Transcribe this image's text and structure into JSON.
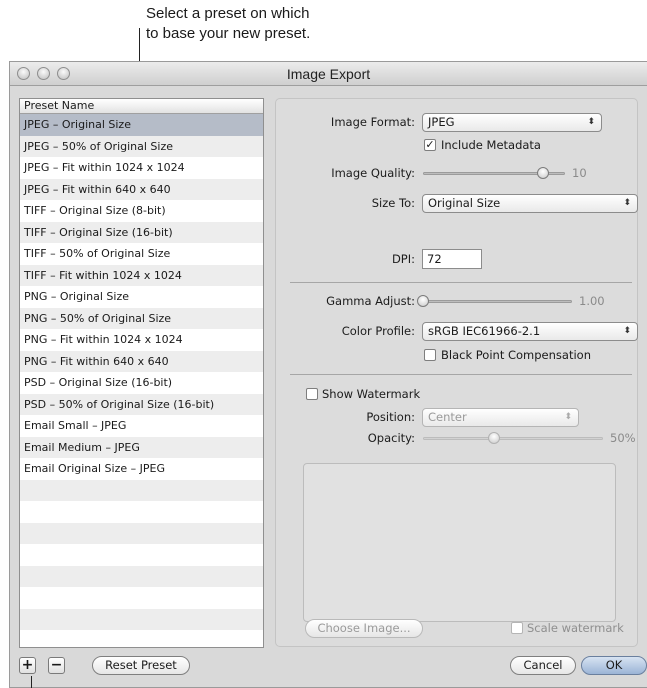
{
  "callout": {
    "line1": "Select a preset on which",
    "line2": "to base your new preset."
  },
  "window": {
    "title": "Image Export"
  },
  "presets": {
    "header": "Preset Name",
    "items": [
      "JPEG – Original Size",
      "JPEG – 50% of Original Size",
      "JPEG – Fit within 1024 x 1024",
      "JPEG – Fit within 640 x 640",
      "TIFF – Original Size (8-bit)",
      "TIFF – Original Size (16-bit)",
      "TIFF – 50% of Original Size",
      "TIFF – Fit within 1024 x 1024",
      "PNG – Original Size",
      "PNG – 50% of Original Size",
      "PNG – Fit within 1024 x 1024",
      "PNG – Fit within 640 x 640",
      "PSD – Original Size (16-bit)",
      "PSD – 50% of Original Size (16-bit)",
      "Email Small – JPEG",
      "Email Medium – JPEG",
      "Email Original Size – JPEG",
      "",
      "",
      "",
      "",
      "",
      "",
      ""
    ],
    "selected_index": 0
  },
  "settings": {
    "image_format_label": "Image Format:",
    "image_format_value": "JPEG",
    "include_metadata_label": "Include Metadata",
    "include_metadata_checked": "✓",
    "image_quality_label": "Image Quality:",
    "image_quality_value": "10",
    "size_to_label": "Size To:",
    "size_to_value": "Original Size",
    "dpi_label": "DPI:",
    "dpi_value": "72",
    "gamma_label": "Gamma Adjust:",
    "gamma_value": "1.00",
    "color_profile_label": "Color Profile:",
    "color_profile_value": "sRGB IEC61966-2.1",
    "black_point_label": "Black Point Compensation",
    "show_watermark_label": "Show Watermark",
    "position_label": "Position:",
    "position_value": "Center",
    "opacity_label": "Opacity:",
    "opacity_value": "50%",
    "choose_image_label": "Choose Image...",
    "scale_watermark_label": "Scale watermark"
  },
  "footer": {
    "add_symbol": "+",
    "remove_symbol": "−",
    "reset_preset_label": "Reset Preset",
    "cancel_label": "Cancel",
    "ok_label": "OK"
  },
  "popup_arrows": "⬍"
}
